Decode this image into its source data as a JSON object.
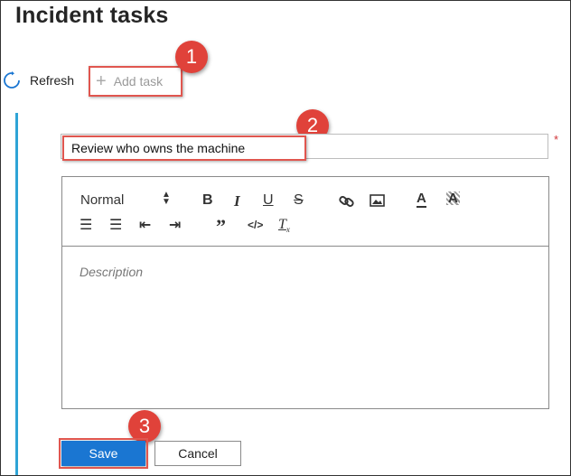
{
  "panel": {
    "title": "Incident tasks"
  },
  "toolbar": {
    "refresh_label": "Refresh",
    "refresh_icon": "refresh-icon",
    "add_task_label": "Add task",
    "add_task_icon": "plus-icon"
  },
  "callouts": [
    "1",
    "2",
    "3"
  ],
  "task_form": {
    "title_value": "Review who owns the machine",
    "required_marker": "*",
    "editor": {
      "font_select_value": "Normal",
      "buttons": [
        "bold",
        "italic",
        "underline",
        "strikethrough",
        "link",
        "image",
        "font-color",
        "highlight",
        "numbered-list",
        "bulleted-list",
        "outdent",
        "indent",
        "blockquote",
        "code",
        "clear-format"
      ],
      "description_placeholder": "Description"
    },
    "save_label": "Save",
    "cancel_label": "Cancel"
  },
  "colors": {
    "accent_blue": "#1a76d2",
    "callout_red": "#e0423a",
    "left_accent": "#2ea4d6"
  }
}
